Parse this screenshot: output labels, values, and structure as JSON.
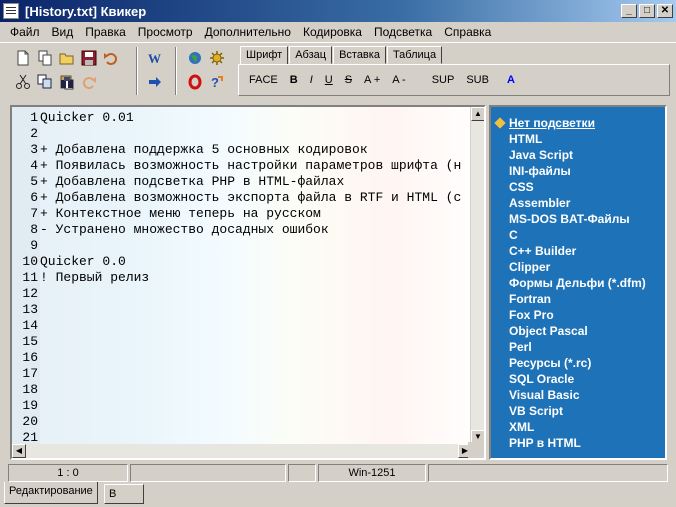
{
  "window": {
    "title": "[History.txt] Квикер",
    "buttons": [
      "_",
      "□",
      "✕"
    ]
  },
  "menu": [
    "Файл",
    "Вид",
    "Правка",
    "Просмотр",
    "Дополнительно",
    "Кодировка",
    "Подсветка",
    "Справка"
  ],
  "toolbar": {
    "group1_icons": [
      "new-file-icon",
      "open-icon",
      "save-icon",
      "undo-icon",
      "cut-icon",
      "copy-icon",
      "paste-icon",
      "find-icon",
      "redo-icon"
    ],
    "group2_icons": [
      "word-icon",
      "export-icon"
    ],
    "group3_icons": [
      "globe-icon",
      "settings-icon",
      "opera-icon",
      "help-icon"
    ]
  },
  "format_tabs": [
    "Шрифт",
    "Абзац",
    "Вставка",
    "Таблица"
  ],
  "format_buttons": [
    "FACE",
    "B",
    "I",
    "U",
    "S",
    "A +",
    "A -",
    "SUP",
    "SUB",
    "A"
  ],
  "editor": {
    "lines": [
      {
        "n": "1",
        "t": "Quicker 0.01"
      },
      {
        "n": "2",
        "t": ""
      },
      {
        "n": "3",
        "t": "+ Добавлена поддержка 5 основных кодировок"
      },
      {
        "n": "4",
        "t": "+ Появилась возможность настройки параметров шрифта (н"
      },
      {
        "n": "5",
        "t": "+ Добавлена подсветка PHP в HTML-файлах"
      },
      {
        "n": "6",
        "t": "+ Добавлена возможность экспорта файла в RTF и HTML (с"
      },
      {
        "n": "7",
        "t": "+ Контекстное меню теперь на русском"
      },
      {
        "n": "8",
        "t": "- Устранено множество досадных ошибок"
      },
      {
        "n": "9",
        "t": ""
      },
      {
        "n": "10",
        "t": "Quicker 0.0"
      },
      {
        "n": "11",
        "t": "! Первый релиз"
      },
      {
        "n": "12",
        "t": ""
      },
      {
        "n": "13",
        "t": ""
      },
      {
        "n": "14",
        "t": ""
      },
      {
        "n": "15",
        "t": ""
      },
      {
        "n": "16",
        "t": ""
      },
      {
        "n": "17",
        "t": ""
      },
      {
        "n": "18",
        "t": ""
      },
      {
        "n": "19",
        "t": ""
      },
      {
        "n": "20",
        "t": ""
      },
      {
        "n": "21",
        "t": ""
      }
    ]
  },
  "highlight_list": [
    "Нет подсветки",
    "HTML",
    "Java Script",
    "INI-файлы",
    "CSS",
    "Assembler",
    "MS-DOS BAT-Файлы",
    "C",
    "C++ Builder",
    "Clipper",
    "Формы Дельфи (*.dfm)",
    "Fortran",
    "Fox Pro",
    "Object Pascal",
    "Perl",
    "Ресурсы (*.rc)",
    "SQL Oracle",
    "Visual Basic",
    "VB Script",
    "XML",
    "PHP в HTML"
  ],
  "status": {
    "position": "1 : 0",
    "field2": "",
    "field3": "",
    "encoding": "Win-1251",
    "field5": ""
  },
  "bottom_tabs": [
    "Редактирование",
    "В виде HTML"
  ],
  "colors": {
    "side_panel": "#1e72b8",
    "title_start": "#0a246a",
    "title_end": "#a6caf0"
  }
}
